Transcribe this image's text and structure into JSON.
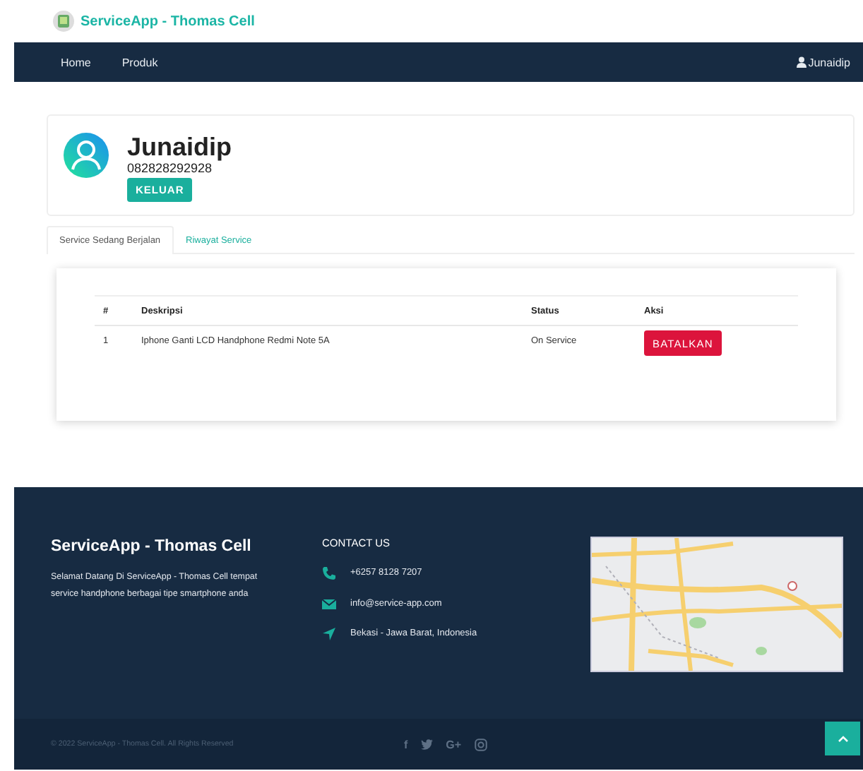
{
  "brand": {
    "title": "ServiceApp - Thomas Cell"
  },
  "nav": {
    "items": [
      {
        "label": "Home"
      },
      {
        "label": "Produk"
      }
    ],
    "user": "Junaidip"
  },
  "profile": {
    "name": "Junaidip",
    "phone": "082828292928",
    "logout": "KELUAR"
  },
  "tabs": [
    {
      "label": "Service Sedang Berjalan",
      "selected": true
    },
    {
      "label": "Riwayat Service",
      "selected": false
    }
  ],
  "table": {
    "columns": [
      "#",
      "Deskripsi",
      "Status",
      "Aksi"
    ],
    "rows": [
      {
        "no": "1",
        "description": "Iphone Ganti LCD Handphone Redmi Note 5A",
        "status": "On Service",
        "action": "BATALKAN"
      }
    ]
  },
  "footer": {
    "title": "ServiceApp - Thomas Cell",
    "about": "Selamat Datang Di ServiceApp - Thomas Cell tempat service handphone berbagai tipe smartphone anda",
    "contact_heading": "CONTACT US",
    "contacts": [
      {
        "kind": "phone",
        "text": "+6257 8128 7207"
      },
      {
        "kind": "email",
        "text": "info@service-app.com"
      },
      {
        "kind": "location",
        "text": "Bekasi - Jawa Barat, Indonesia"
      }
    ],
    "copyright": "© 2022 ServiceApp - Thomas Cell. All Rights Reserved",
    "social": [
      {
        "kind": "facebook",
        "text": "f"
      },
      {
        "kind": "twitter"
      },
      {
        "kind": "googleplus",
        "text": "G+"
      },
      {
        "kind": "instagram"
      }
    ]
  }
}
